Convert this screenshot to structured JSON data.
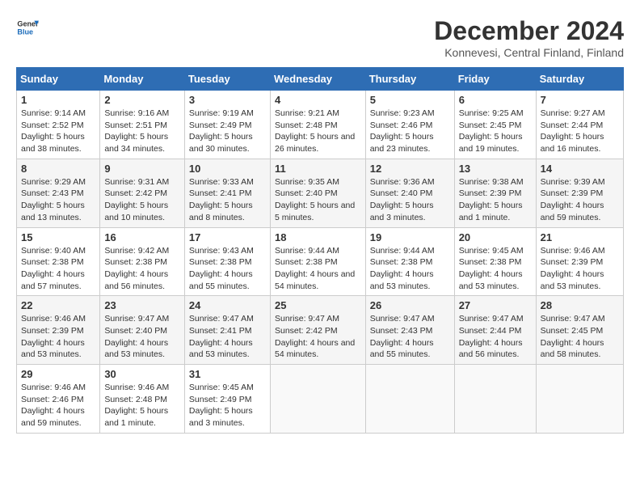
{
  "logo": {
    "line1": "General",
    "line2": "Blue"
  },
  "title": "December 2024",
  "subtitle": "Konnevesi, Central Finland, Finland",
  "days_header": [
    "Sunday",
    "Monday",
    "Tuesday",
    "Wednesday",
    "Thursday",
    "Friday",
    "Saturday"
  ],
  "weeks": [
    [
      {
        "day": "1",
        "sunrise": "9:14 AM",
        "sunset": "2:52 PM",
        "daylight": "5 hours and 38 minutes."
      },
      {
        "day": "2",
        "sunrise": "9:16 AM",
        "sunset": "2:51 PM",
        "daylight": "5 hours and 34 minutes."
      },
      {
        "day": "3",
        "sunrise": "9:19 AM",
        "sunset": "2:49 PM",
        "daylight": "5 hours and 30 minutes."
      },
      {
        "day": "4",
        "sunrise": "9:21 AM",
        "sunset": "2:48 PM",
        "daylight": "5 hours and 26 minutes."
      },
      {
        "day": "5",
        "sunrise": "9:23 AM",
        "sunset": "2:46 PM",
        "daylight": "5 hours and 23 minutes."
      },
      {
        "day": "6",
        "sunrise": "9:25 AM",
        "sunset": "2:45 PM",
        "daylight": "5 hours and 19 minutes."
      },
      {
        "day": "7",
        "sunrise": "9:27 AM",
        "sunset": "2:44 PM",
        "daylight": "5 hours and 16 minutes."
      }
    ],
    [
      {
        "day": "8",
        "sunrise": "9:29 AM",
        "sunset": "2:43 PM",
        "daylight": "5 hours and 13 minutes."
      },
      {
        "day": "9",
        "sunrise": "9:31 AM",
        "sunset": "2:42 PM",
        "daylight": "5 hours and 10 minutes."
      },
      {
        "day": "10",
        "sunrise": "9:33 AM",
        "sunset": "2:41 PM",
        "daylight": "5 hours and 8 minutes."
      },
      {
        "day": "11",
        "sunrise": "9:35 AM",
        "sunset": "2:40 PM",
        "daylight": "5 hours and 5 minutes."
      },
      {
        "day": "12",
        "sunrise": "9:36 AM",
        "sunset": "2:40 PM",
        "daylight": "5 hours and 3 minutes."
      },
      {
        "day": "13",
        "sunrise": "9:38 AM",
        "sunset": "2:39 PM",
        "daylight": "5 hours and 1 minute."
      },
      {
        "day": "14",
        "sunrise": "9:39 AM",
        "sunset": "2:39 PM",
        "daylight": "4 hours and 59 minutes."
      }
    ],
    [
      {
        "day": "15",
        "sunrise": "9:40 AM",
        "sunset": "2:38 PM",
        "daylight": "4 hours and 57 minutes."
      },
      {
        "day": "16",
        "sunrise": "9:42 AM",
        "sunset": "2:38 PM",
        "daylight": "4 hours and 56 minutes."
      },
      {
        "day": "17",
        "sunrise": "9:43 AM",
        "sunset": "2:38 PM",
        "daylight": "4 hours and 55 minutes."
      },
      {
        "day": "18",
        "sunrise": "9:44 AM",
        "sunset": "2:38 PM",
        "daylight": "4 hours and 54 minutes."
      },
      {
        "day": "19",
        "sunrise": "9:44 AM",
        "sunset": "2:38 PM",
        "daylight": "4 hours and 53 minutes."
      },
      {
        "day": "20",
        "sunrise": "9:45 AM",
        "sunset": "2:38 PM",
        "daylight": "4 hours and 53 minutes."
      },
      {
        "day": "21",
        "sunrise": "9:46 AM",
        "sunset": "2:39 PM",
        "daylight": "4 hours and 53 minutes."
      }
    ],
    [
      {
        "day": "22",
        "sunrise": "9:46 AM",
        "sunset": "2:39 PM",
        "daylight": "4 hours and 53 minutes."
      },
      {
        "day": "23",
        "sunrise": "9:47 AM",
        "sunset": "2:40 PM",
        "daylight": "4 hours and 53 minutes."
      },
      {
        "day": "24",
        "sunrise": "9:47 AM",
        "sunset": "2:41 PM",
        "daylight": "4 hours and 53 minutes."
      },
      {
        "day": "25",
        "sunrise": "9:47 AM",
        "sunset": "2:42 PM",
        "daylight": "4 hours and 54 minutes."
      },
      {
        "day": "26",
        "sunrise": "9:47 AM",
        "sunset": "2:43 PM",
        "daylight": "4 hours and 55 minutes."
      },
      {
        "day": "27",
        "sunrise": "9:47 AM",
        "sunset": "2:44 PM",
        "daylight": "4 hours and 56 minutes."
      },
      {
        "day": "28",
        "sunrise": "9:47 AM",
        "sunset": "2:45 PM",
        "daylight": "4 hours and 58 minutes."
      }
    ],
    [
      {
        "day": "29",
        "sunrise": "9:46 AM",
        "sunset": "2:46 PM",
        "daylight": "4 hours and 59 minutes."
      },
      {
        "day": "30",
        "sunrise": "9:46 AM",
        "sunset": "2:48 PM",
        "daylight": "5 hours and 1 minute."
      },
      {
        "day": "31",
        "sunrise": "9:45 AM",
        "sunset": "2:49 PM",
        "daylight": "5 hours and 3 minutes."
      },
      null,
      null,
      null,
      null
    ]
  ]
}
